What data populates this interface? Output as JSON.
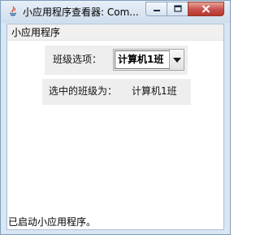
{
  "window": {
    "title": "小应用程序查看器: Com...",
    "icon": "java-icon",
    "controls": {
      "minimize": "minimize-icon",
      "maximize": "maximize-icon",
      "close": "close-icon"
    }
  },
  "menubar": {
    "menu_label": "小应用程序"
  },
  "form": {
    "class_label": "班级选项：",
    "class_select_value": "计算机1班",
    "selected_label": "选中的班级为：",
    "selected_value": "计算机1班"
  },
  "status": {
    "text": "已启动小应用程序。"
  },
  "colors": {
    "close_button": "#c75050",
    "panel_bg": "#eeeeee",
    "frame": "#d9e6f3"
  }
}
